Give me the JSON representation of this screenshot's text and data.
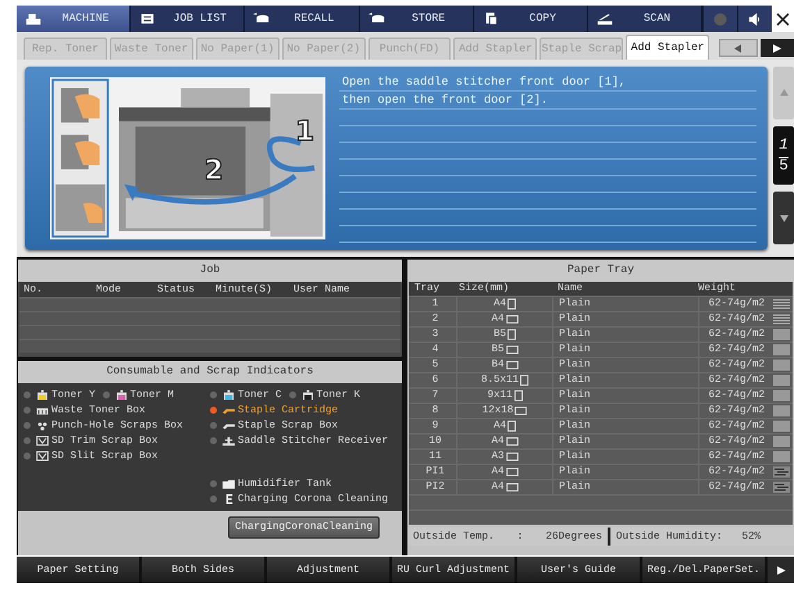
{
  "top_tabs": [
    {
      "label": "MACHINE",
      "kind": "machine",
      "selected": true
    },
    {
      "label": "JOB LIST",
      "kind": "list",
      "selected": false
    },
    {
      "label": "RECALL",
      "kind": "recall",
      "selected": false
    },
    {
      "label": "STORE",
      "kind": "store",
      "selected": false
    },
    {
      "label": "COPY",
      "kind": "copy",
      "selected": false
    },
    {
      "label": "SCAN",
      "kind": "scan",
      "selected": false
    }
  ],
  "warning_tabs": [
    {
      "label": "Rep. Toner",
      "selected": false
    },
    {
      "label": "Waste Toner",
      "selected": false
    },
    {
      "label": "No Paper(1)",
      "selected": false
    },
    {
      "label": "No Paper(2)",
      "selected": false
    },
    {
      "label": "Punch(FD)",
      "selected": false
    },
    {
      "label": "Add Stapler",
      "selected": false
    },
    {
      "label": "Staple Scrap",
      "selected": false
    },
    {
      "label": "Add Stapler",
      "selected": true
    }
  ],
  "guide": {
    "callouts": [
      "1",
      "2"
    ],
    "lines": [
      "Open the saddle stitcher front door [1],",
      "then open the front door [2]."
    ],
    "page_current": "1",
    "page_total": "5"
  },
  "job": {
    "title": "Job",
    "columns": [
      "No.",
      "Mode",
      "Status",
      "Minute(S)",
      "User Name"
    ]
  },
  "indicators": {
    "title": "Consumable and Scrap Indicators",
    "left_rows": [
      [
        {
          "label": "Toner Y",
          "kind": "toner",
          "color": "#f0d020",
          "alert": false
        },
        {
          "label": "Toner M",
          "kind": "toner",
          "color": "#e060b0",
          "alert": false
        }
      ],
      [
        {
          "label": "Waste Toner Box",
          "kind": "waste",
          "alert": false
        }
      ],
      [
        {
          "label": "Punch-Hole Scraps Box",
          "kind": "punch",
          "alert": false
        }
      ],
      [
        {
          "label": "SD Trim Scrap Box",
          "kind": "trim",
          "alert": false
        }
      ],
      [
        {
          "label": "SD Slit Scrap Box",
          "kind": "trim",
          "alert": false
        }
      ]
    ],
    "right_rows": [
      [
        {
          "label": "Toner C",
          "kind": "toner",
          "color": "#40b8e0",
          "alert": false
        },
        {
          "label": "Toner K",
          "kind": "toner",
          "color": "#202020",
          "alert": false
        }
      ],
      [
        {
          "label": "Staple Cartridge",
          "kind": "staple",
          "alert": true
        }
      ],
      [
        {
          "label": "Staple Scrap Box",
          "kind": "staple",
          "alert": false
        }
      ],
      [
        {
          "label": "Saddle Stitcher Receiver",
          "kind": "saddle",
          "alert": false
        }
      ]
    ],
    "right_bottom_rows": [
      [
        {
          "label": "Humidifier Tank",
          "kind": "humidifier",
          "alert": false
        }
      ],
      [
        {
          "label": "Charging Corona Cleaning",
          "kind": "corona",
          "alert": false
        }
      ]
    ],
    "button": "ChargingCoronaCleaning"
  },
  "paper_tray": {
    "title": "Paper Tray",
    "columns": [
      "Tray",
      "Size(mm)",
      "Name",
      "Weight"
    ],
    "rows": [
      {
        "tray": "1",
        "size": "A4",
        "portrait": true,
        "name": "Plain",
        "weight": "62-74g/m2",
        "kind": "lines"
      },
      {
        "tray": "2",
        "size": "A4",
        "portrait": false,
        "name": "Plain",
        "weight": "62-74g/m2",
        "kind": "lines"
      },
      {
        "tray": "3",
        "size": "B5",
        "portrait": true,
        "name": "Plain",
        "weight": "62-74g/m2",
        "kind": "plain"
      },
      {
        "tray": "4",
        "size": "B5",
        "portrait": false,
        "name": "Plain",
        "weight": "62-74g/m2",
        "kind": "plain"
      },
      {
        "tray": "5",
        "size": "B4",
        "portrait": false,
        "name": "Plain",
        "weight": "62-74g/m2",
        "kind": "plain"
      },
      {
        "tray": "6",
        "size": "8.5x11",
        "portrait": true,
        "name": "Plain",
        "weight": "62-74g/m2",
        "kind": "plain"
      },
      {
        "tray": "7",
        "size": "9x11",
        "portrait": true,
        "name": "Plain",
        "weight": "62-74g/m2",
        "kind": "plain"
      },
      {
        "tray": "8",
        "size": "12x18",
        "portrait": false,
        "name": "Plain",
        "weight": "62-74g/m2",
        "kind": "plain"
      },
      {
        "tray": "9",
        "size": "A4",
        "portrait": true,
        "name": "Plain",
        "weight": "62-74g/m2",
        "kind": "plain"
      },
      {
        "tray": "10",
        "size": "A4",
        "portrait": false,
        "name": "Plain",
        "weight": "62-74g/m2",
        "kind": "plain"
      },
      {
        "tray": "11",
        "size": "A3",
        "portrait": false,
        "name": "Plain",
        "weight": "62-74g/m2",
        "kind": "plain"
      },
      {
        "tray": "PI1",
        "size": "A4",
        "portrait": false,
        "name": "Plain",
        "weight": "62-74g/m2",
        "kind": "pattern"
      },
      {
        "tray": "PI2",
        "size": "A4",
        "portrait": false,
        "name": "Plain",
        "weight": "62-74g/m2",
        "kind": "pattern"
      }
    ],
    "temp_label": "Outside Temp.",
    "temp_sep": ":",
    "temp_value": "26Degrees",
    "humidity_label": "Outside Humidity:",
    "humidity_value": "52%"
  },
  "function_keys": [
    "Paper Setting",
    "Both Sides",
    "Adjustment",
    "RU Curl Adjustment",
    "User's Guide",
    "Reg./Del.PaperSet."
  ]
}
